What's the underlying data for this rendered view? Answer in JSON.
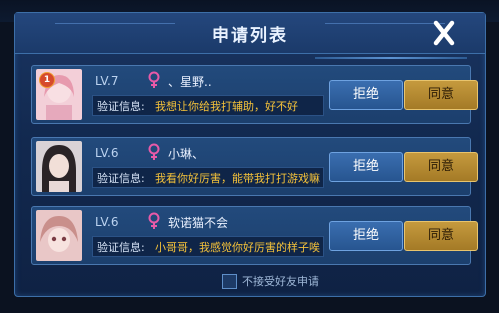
{
  "dialog": {
    "title": "申请列表",
    "close_icon": "close-icon"
  },
  "requests": [
    {
      "level": "LV.7",
      "name": "、星野..",
      "gender": "female",
      "rank_badge": "1",
      "verify_label": "验证信息:",
      "verify_text": "我想让你给我打辅助，好不好",
      "reject_label": "拒绝",
      "accept_label": "同意"
    },
    {
      "level": "LV.6",
      "name": "小琳、",
      "gender": "female",
      "verify_label": "验证信息:",
      "verify_text": "我看你好厉害，能带我打打游戏嘛",
      "reject_label": "拒绝",
      "accept_label": "同意"
    },
    {
      "level": "LV.6",
      "name": "软诺猫不会",
      "gender": "female",
      "verify_label": "验证信息:",
      "verify_text": "小哥哥，我感觉你好厉害的样子唉",
      "reject_label": "拒绝",
      "accept_label": "同意"
    }
  ],
  "footer": {
    "checkbox_label": "不接受好友申请",
    "checked": false
  },
  "colors": {
    "accent_gold": "#f5c23a",
    "gender_pink": "#e85aa8",
    "reject_blue": "#3a6eb0",
    "accept_gold": "#c59a3e"
  }
}
